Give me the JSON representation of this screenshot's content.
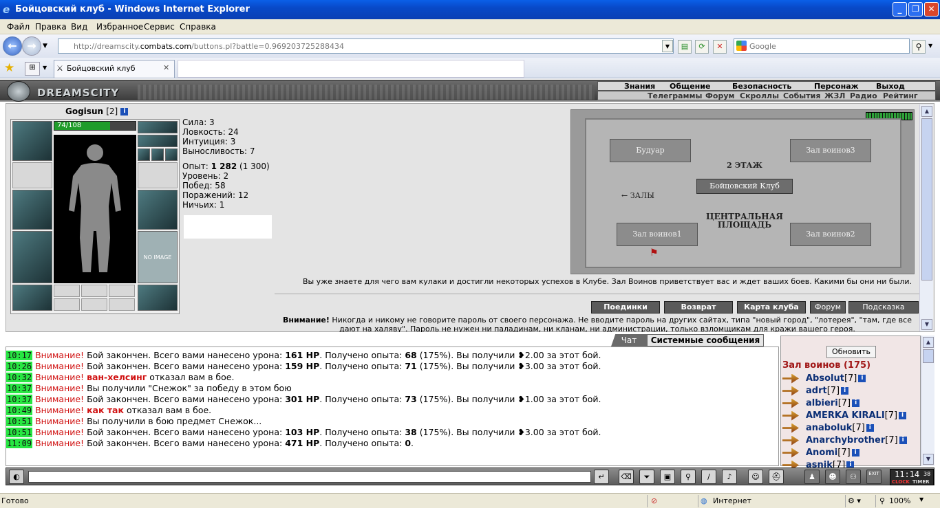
{
  "window": {
    "title": "Бойцовский клуб - Windows Internet Explorer"
  },
  "menu": [
    "Файл",
    "Правка",
    "Вид",
    "Избранное",
    "Сервис",
    "Справка"
  ],
  "address": {
    "prefix": "http://dreamscity.",
    "domain": "combats.com",
    "path": "/buttons.pl?battle=0.969203725288434"
  },
  "search": {
    "placeholder": "Google"
  },
  "tab": {
    "label": "Бойцовский клуб"
  },
  "logo": {
    "text": "DREAMSCITY"
  },
  "top_menu": [
    "Знания",
    "Общение",
    "Безопасность",
    "Персонаж",
    "Выход"
  ],
  "sub_menu": [
    "Телеграммы",
    "Форум",
    "Скроллы",
    "События",
    "ЖЗЛ",
    "Радио",
    "Рейтинг"
  ],
  "character": {
    "name": "Gogisun",
    "level": "[2]",
    "hp_text": "74/108",
    "hp_fraction": 0.685,
    "no_image": "NO IMAGE"
  },
  "stats": [
    "Сила: 3",
    "Ловкость: 24",
    "Интуиция: 3",
    "Выносливость: 7"
  ],
  "stats2": {
    "exp_label": "Опыт: ",
    "exp_value": "1 282",
    "exp_next": " (1 300)",
    "level": "Уровень: 2",
    "wins": "Побед: 58",
    "losses": "Поражений: 12",
    "draws": "Ничьих: 1"
  },
  "map": {
    "rooms": [
      "Будуар",
      "Зал воинов3",
      "Зал воинов1",
      "Зал воинов2"
    ],
    "floor": "2 ЭТАЖ",
    "center": "Бойцовский Клуб",
    "halls": "← ЗАЛЫ",
    "square_line1": "ЦЕНТРАЛЬНАЯ",
    "square_line2": "ПЛОЩАДЬ"
  },
  "welcome_text": "Вы уже знаете для чего вам кулаки и достигли некоторых успехов в Клубе. Зал Воинов приветствует вас и ждет ваших боев. Какими бы они ни были.",
  "buttons": [
    "Поединки",
    "Возврат",
    "Карта клуба",
    "Форум",
    "Подсказка"
  ],
  "warning": {
    "label": "Внимание!",
    "text": " Никогда и никому не говорите пароль от своего персонажа. Не вводите пароль на других сайтах, типа \"новый город\", \"лотерея\", \"там, где все дают на халяву\". Пароль не нужен ни паладинам, ни кланам, ни администрации, только взломщикам для кражи вашего героя."
  },
  "chat_tabs": {
    "chat": "Чат",
    "system": "Системные сообщения"
  },
  "messages": [
    {
      "time": "10:17",
      "alert": "Внимание!",
      "parts": [
        [
          "",
          "Бой закончен. Всего вами нанесено урона: "
        ],
        [
          "b",
          "161 HP"
        ],
        [
          "",
          ". Получено опыта: "
        ],
        [
          "b",
          "68"
        ],
        [
          "",
          " (175%). Вы получили ❥2.00 за этот бой."
        ]
      ]
    },
    {
      "time": "10:26",
      "alert": "Внимание!",
      "parts": [
        [
          "",
          "Бой закончен. Всего вами нанесено урона: "
        ],
        [
          "b",
          "159 HP"
        ],
        [
          "",
          ". Получено опыта: "
        ],
        [
          "b",
          "71"
        ],
        [
          "",
          " (175%). Вы получили ❥3.00 за этот бой."
        ]
      ]
    },
    {
      "time": "10:32",
      "alert": "Внимание!",
      "parts": [
        [
          "rb",
          "ван-хелсинг"
        ],
        [
          "",
          " отказал вам в бое."
        ]
      ]
    },
    {
      "time": "10:37",
      "alert": "Внимание!",
      "parts": [
        [
          "",
          "Вы получили \"Снежок\" за победу в этом бою"
        ]
      ]
    },
    {
      "time": "10:37",
      "alert": "Внимание!",
      "parts": [
        [
          "",
          "Бой закончен. Всего вами нанесено урона: "
        ],
        [
          "b",
          "301 HP"
        ],
        [
          "",
          ". Получено опыта: "
        ],
        [
          "b",
          "73"
        ],
        [
          "",
          " (175%). Вы получили ❥1.00 за этот бой."
        ]
      ]
    },
    {
      "time": "10:49",
      "alert": "Внимание!",
      "parts": [
        [
          "rb",
          "как так"
        ],
        [
          "",
          " отказал вам в бое."
        ]
      ]
    },
    {
      "time": "10:51",
      "alert": "Внимание!",
      "parts": [
        [
          "",
          "Вы получили в бою предмет Снежок..."
        ]
      ]
    },
    {
      "time": "10:51",
      "alert": "Внимание!",
      "parts": [
        [
          "",
          "Бой закончен. Всего вами нанесено урона: "
        ],
        [
          "b",
          "103 HP"
        ],
        [
          "",
          ". Получено опыта: "
        ],
        [
          "b",
          "38"
        ],
        [
          "",
          " (175%). Вы получили ❥3.00 за этот бой."
        ]
      ]
    },
    {
      "time": "11:09",
      "alert": "Внимание!",
      "parts": [
        [
          "",
          "Бой закончен. Всего вами нанесено урона: "
        ],
        [
          "b",
          "471 HP"
        ],
        [
          "",
          ". Получено опыта: "
        ],
        [
          "b",
          "0"
        ],
        [
          "",
          "."
        ]
      ]
    }
  ],
  "users_panel": {
    "refresh": "Обновить",
    "room": "Зал воинов (175)",
    "users": [
      {
        "name": "Absolut",
        "level": "[7]"
      },
      {
        "name": "adrt",
        "level": "[7]"
      },
      {
        "name": "albieri",
        "level": "[7]"
      },
      {
        "name": "AMERKA KIRALI",
        "level": "[7]"
      },
      {
        "name": "anaboluk",
        "level": "[7]"
      },
      {
        "name": "Anarchybrother",
        "level": "[7]"
      },
      {
        "name": "Anomi",
        "level": "[7]"
      },
      {
        "name": "asnik",
        "level": "[7]"
      }
    ]
  },
  "clock": {
    "time": "11:14",
    "seconds": "38",
    "clock_label": "CLOCK",
    "timer_label": "TIMER",
    "exit": "EXIT"
  },
  "status": {
    "ready": "Готово",
    "zone": "Интернет",
    "zoom": "100%"
  },
  "colors": {
    "accent_green": "#27e642",
    "alert_red": "#d01010",
    "user_blue": "#0c2f76"
  }
}
